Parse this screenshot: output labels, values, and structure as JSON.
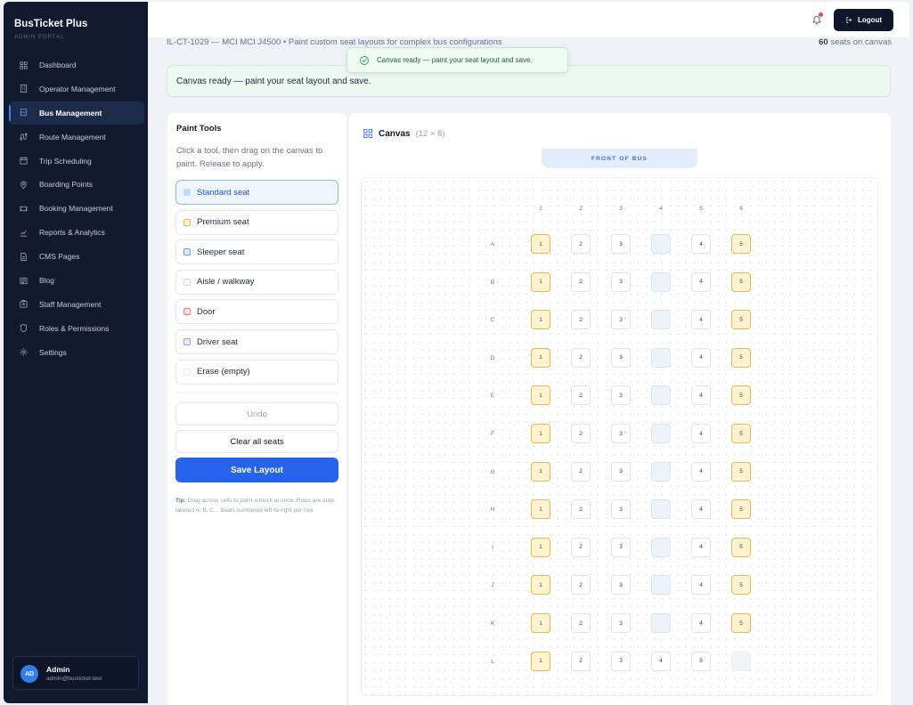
{
  "app": {
    "name": "BusTicket Plus",
    "subtitle": "ADMIN PORTAL"
  },
  "sidebar": {
    "items": [
      {
        "label": "Dashboard",
        "icon": "grid-icon",
        "active": false
      },
      {
        "label": "Operator Management",
        "icon": "building-icon",
        "active": false
      },
      {
        "label": "Bus Management",
        "icon": "bus-icon",
        "active": true
      },
      {
        "label": "Route Management",
        "icon": "route-icon",
        "active": false
      },
      {
        "label": "Trip Scheduling",
        "icon": "calendar-icon",
        "active": false
      },
      {
        "label": "Boarding Points",
        "icon": "map-pin-icon",
        "active": false
      },
      {
        "label": "Booking Management",
        "icon": "ticket-icon",
        "active": false
      },
      {
        "label": "Reports & Analytics",
        "icon": "chart-icon",
        "active": false
      },
      {
        "label": "CMS Pages",
        "icon": "file-icon",
        "active": false
      },
      {
        "label": "Blog",
        "icon": "newspaper-icon",
        "active": false
      },
      {
        "label": "Staff Management",
        "icon": "badge-icon",
        "active": false
      },
      {
        "label": "Roles & Permissions",
        "icon": "shield-icon",
        "active": false
      },
      {
        "label": "Settings",
        "icon": "gear-icon",
        "active": false
      }
    ]
  },
  "user": {
    "initials": "AD",
    "name": "Admin",
    "email": "admin@busticket.test"
  },
  "topbar": {
    "logout_label": "Logout"
  },
  "header": {
    "breadcrumb": "IL-CT-1029 — MCI MCI J4500  •  Paint custom seat layouts for complex bus configurations",
    "seat_count": "60",
    "seat_count_suffix": " seats on canvas"
  },
  "toast": {
    "message": "Canvas ready — paint your seat layout and save."
  },
  "banner": {
    "message": "Canvas ready — paint your seat layout and save."
  },
  "tools": {
    "title": "Paint Tools",
    "description": "Click a tool, then drag on the canvas to paint. Release to apply.",
    "items": [
      {
        "label": "Standard seat",
        "color": "#bfdbfe",
        "border": "#bfdbfe",
        "active": true
      },
      {
        "label": "Premium seat",
        "color": "#fdf3d0",
        "border": "#e5b84a",
        "active": false
      },
      {
        "label": "Sleeper seat",
        "color": "#dbeafe",
        "border": "#60a5fa",
        "active": false
      },
      {
        "label": "Aisle / walkway",
        "color": "#ffffff",
        "border": "#d1d5db",
        "active": false
      },
      {
        "label": "Door",
        "color": "#fee2e2",
        "border": "#f87171",
        "active": false
      },
      {
        "label": "Driver seat",
        "color": "#ede9fe",
        "border": "#a78bfa",
        "active": false
      },
      {
        "label": "Erase (empty)",
        "color": "#ffffff",
        "border": "#e5e7eb",
        "active": false
      }
    ],
    "undo_label": "Undo",
    "clear_label": "Clear all seats",
    "save_label": "Save Layout",
    "tip_label": "Tip:",
    "tip_text": " Drag across cells to paint a block at once. Rows are auto-labeled A, B, C... Seats numbered left-to-right per row."
  },
  "canvas": {
    "title": "Canvas",
    "dims": "(12 × 6)",
    "front_label": "FRONT OF BUS",
    "columns": [
      "1",
      "2",
      "3",
      "4",
      "5",
      "6"
    ],
    "rows": [
      {
        "label": "A",
        "cells": [
          {
            "t": "premium",
            "n": "1"
          },
          {
            "t": "standard",
            "n": "2"
          },
          {
            "t": "standard",
            "n": "3"
          },
          {
            "t": "aisle",
            "n": ""
          },
          {
            "t": "standard",
            "n": "4"
          },
          {
            "t": "premium",
            "n": "5"
          }
        ]
      },
      {
        "label": "B",
        "cells": [
          {
            "t": "premium",
            "n": "1"
          },
          {
            "t": "standard",
            "n": "2"
          },
          {
            "t": "standard",
            "n": "3"
          },
          {
            "t": "aisle",
            "n": ""
          },
          {
            "t": "standard",
            "n": "4"
          },
          {
            "t": "premium",
            "n": "5"
          }
        ]
      },
      {
        "label": "C",
        "cells": [
          {
            "t": "premium",
            "n": "1"
          },
          {
            "t": "standard",
            "n": "2"
          },
          {
            "t": "standard",
            "n": "3"
          },
          {
            "t": "aisle",
            "n": ""
          },
          {
            "t": "standard",
            "n": "4"
          },
          {
            "t": "premium",
            "n": "5"
          }
        ]
      },
      {
        "label": "D",
        "cells": [
          {
            "t": "premium",
            "n": "1"
          },
          {
            "t": "standard",
            "n": "2"
          },
          {
            "t": "standard",
            "n": "3"
          },
          {
            "t": "aisle",
            "n": ""
          },
          {
            "t": "standard",
            "n": "4"
          },
          {
            "t": "premium",
            "n": "5"
          }
        ]
      },
      {
        "label": "E",
        "cells": [
          {
            "t": "premium",
            "n": "1"
          },
          {
            "t": "standard",
            "n": "2"
          },
          {
            "t": "standard",
            "n": "3"
          },
          {
            "t": "aisle",
            "n": ""
          },
          {
            "t": "standard",
            "n": "4"
          },
          {
            "t": "premium",
            "n": "5"
          }
        ]
      },
      {
        "label": "F",
        "cells": [
          {
            "t": "premium",
            "n": "1"
          },
          {
            "t": "standard",
            "n": "2"
          },
          {
            "t": "standard",
            "n": "3"
          },
          {
            "t": "aisle",
            "n": ""
          },
          {
            "t": "standard",
            "n": "4"
          },
          {
            "t": "premium",
            "n": "5"
          }
        ]
      },
      {
        "label": "G",
        "cells": [
          {
            "t": "premium",
            "n": "1"
          },
          {
            "t": "standard",
            "n": "2"
          },
          {
            "t": "standard",
            "n": "3"
          },
          {
            "t": "aisle",
            "n": ""
          },
          {
            "t": "standard",
            "n": "4"
          },
          {
            "t": "premium",
            "n": "5"
          }
        ]
      },
      {
        "label": "H",
        "cells": [
          {
            "t": "premium",
            "n": "1"
          },
          {
            "t": "standard",
            "n": "2"
          },
          {
            "t": "standard",
            "n": "3"
          },
          {
            "t": "aisle",
            "n": ""
          },
          {
            "t": "standard",
            "n": "4"
          },
          {
            "t": "premium",
            "n": "5"
          }
        ]
      },
      {
        "label": "I",
        "cells": [
          {
            "t": "premium",
            "n": "1"
          },
          {
            "t": "standard",
            "n": "2"
          },
          {
            "t": "standard",
            "n": "3"
          },
          {
            "t": "aisle",
            "n": ""
          },
          {
            "t": "standard",
            "n": "4"
          },
          {
            "t": "premium",
            "n": "5"
          }
        ]
      },
      {
        "label": "J",
        "cells": [
          {
            "t": "premium",
            "n": "1"
          },
          {
            "t": "standard",
            "n": "2"
          },
          {
            "t": "standard",
            "n": "3"
          },
          {
            "t": "aisle",
            "n": ""
          },
          {
            "t": "standard",
            "n": "4"
          },
          {
            "t": "premium",
            "n": "5"
          }
        ]
      },
      {
        "label": "K",
        "cells": [
          {
            "t": "premium",
            "n": "1"
          },
          {
            "t": "standard",
            "n": "2"
          },
          {
            "t": "standard",
            "n": "3"
          },
          {
            "t": "aisle",
            "n": ""
          },
          {
            "t": "standard",
            "n": "4"
          },
          {
            "t": "premium",
            "n": "5"
          }
        ]
      },
      {
        "label": "L",
        "cells": [
          {
            "t": "premium",
            "n": "1"
          },
          {
            "t": "standard",
            "n": "2"
          },
          {
            "t": "standard",
            "n": "3"
          },
          {
            "t": "standard",
            "n": "4"
          },
          {
            "t": "standard",
            "n": "5"
          },
          {
            "t": "empty",
            "n": ""
          }
        ]
      }
    ]
  }
}
